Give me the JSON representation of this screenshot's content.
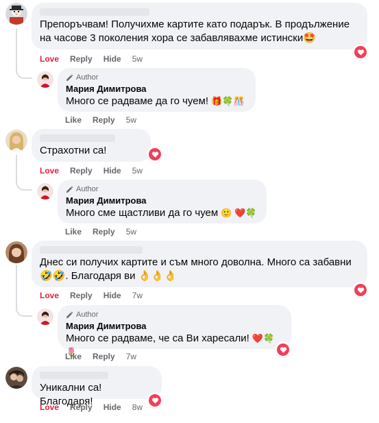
{
  "actions": {
    "love": "Love",
    "reply": "Reply",
    "hide": "Hide",
    "like": "Like"
  },
  "author_badge": "Author",
  "comments": [
    {
      "text": "Препоръчвам! Получихме картите като подарък. В продължение на часове 3 поколения хора се забавлявахме истински",
      "emoji": "🤩",
      "time": "5w",
      "reply": {
        "name": "Мария Димитрова",
        "text": "Много се радваме да го чуем!",
        "emoji": "🎁🍀🎊",
        "time": "5w"
      }
    },
    {
      "text": "Страхотни са!",
      "time": "5w",
      "reply": {
        "name": "Мария Димитрова",
        "text": "Много сме щастливи да го чуем",
        "emoji": "🙂 ❤️🍀",
        "time": "5w"
      }
    },
    {
      "text": "Днес си получих картите и съм много доволна. Много са забавни",
      "text2": ". Благодаря ви",
      "emoji_a": "🤣🤣",
      "emoji_b": "👌👌👌",
      "time": "7w",
      "reply": {
        "name": "Мария Димитрова",
        "text": "Много се радваме, че са Ви харесали!",
        "emoji": "❤️🍀🌷",
        "time": "7w"
      }
    },
    {
      "text": "Уникални са! Благодаря!",
      "time": "8w"
    }
  ],
  "colors": {
    "love": "#e41e3f",
    "bubble": "#f0f2f5",
    "meta": "#65676b",
    "heart": "#f33e58"
  }
}
